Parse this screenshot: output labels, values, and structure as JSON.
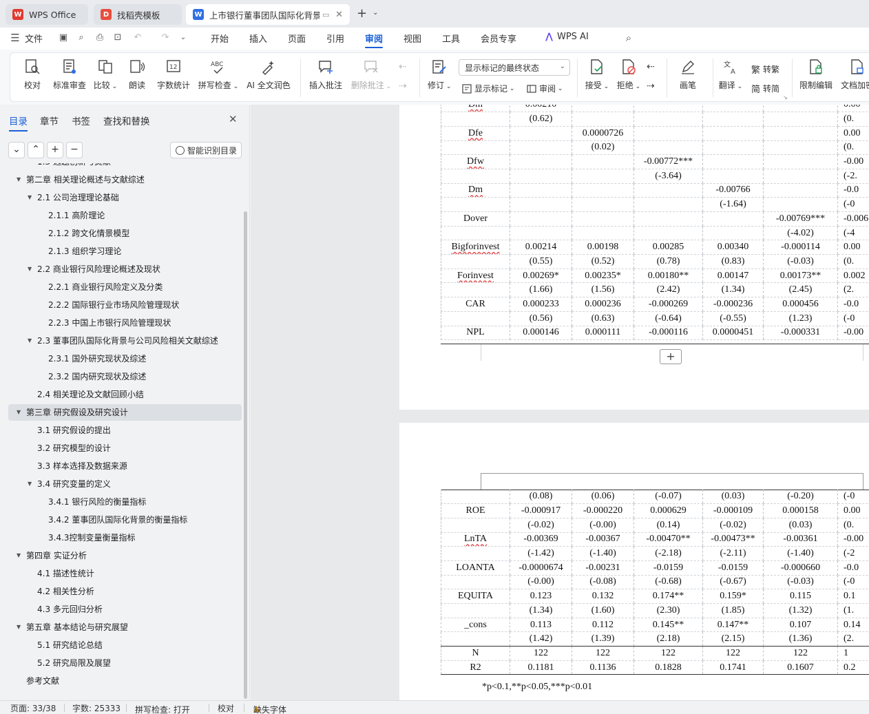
{
  "tabs": [
    {
      "label": "WPS Office",
      "icon": "wps-logo-icon"
    },
    {
      "label": "找稻壳模板",
      "icon": "docer-icon"
    },
    {
      "label": "上市银行董事团队国际化背景对",
      "icon": "word-doc-icon"
    }
  ],
  "menu": {
    "file": "文件",
    "items": [
      "开始",
      "插入",
      "页面",
      "引用",
      "审阅",
      "视图",
      "工具",
      "会员专享"
    ],
    "active": "审阅",
    "ai": "WPS AI"
  },
  "ribbon": {
    "proof": "校对",
    "standard_review": "标准审查",
    "compare": "比较",
    "read_aloud": "朗读",
    "word_count": "字数统计",
    "spell_check": "拼写检查",
    "ai_polish": "AI 全文润色",
    "insert_comment": "插入批注",
    "delete_comment": "删除批注",
    "revise": "修订",
    "show_markup": "显示标记",
    "review": "审阅",
    "display_state": "显示标记的最终状态",
    "accept": "接受",
    "reject": "拒绝",
    "pen": "画笔",
    "translate": "翻译",
    "to_trad": "转繁",
    "to_simp": "转简",
    "restrict_edit": "限制编辑",
    "doc_encrypt": "文档加密"
  },
  "panel": {
    "tabs": [
      "目录",
      "章节",
      "书签",
      "查找和替换"
    ],
    "active_tab": "目录",
    "ai_toc": "智能识别目录",
    "toc": [
      {
        "label": "1.3  选题创新与贡献",
        "level": 2
      },
      {
        "label": "第二章  相关理论概述与文献综述",
        "level": 1,
        "expanded": true
      },
      {
        "label": "2.1  公司治理理论基础",
        "level": 2,
        "expanded": true
      },
      {
        "label": "2.1.1  高阶理论",
        "level": 3
      },
      {
        "label": "2.1.2  跨文化情景模型",
        "level": 3
      },
      {
        "label": "2.1.3 组织学习理论",
        "level": 3
      },
      {
        "label": "2.2 商业银行风险理论概述及现状",
        "level": 2,
        "expanded": true
      },
      {
        "label": "2.2.1  商业银行风险定义及分类",
        "level": 3
      },
      {
        "label": "2.2.2  国际银行业市场风险管理现状",
        "level": 3
      },
      {
        "label": "2.2.3  中国上市银行风险管理现状",
        "level": 3
      },
      {
        "label": "2.3  董事团队国际化背景与公司风险相关文献综述",
        "level": 2,
        "expanded": true
      },
      {
        "label": "2.3.1  国外研究现状及综述",
        "level": 3
      },
      {
        "label": "2.3.2  国内研究现状及综述",
        "level": 3
      },
      {
        "label": "2.4 相关理论及文献回顾小结",
        "level": 2
      },
      {
        "label": "第三章  研究假设及研究设计",
        "level": 1,
        "expanded": true,
        "selected": true
      },
      {
        "label": "3.1  研究假设的提出",
        "level": 2
      },
      {
        "label": "3.2  研究模型的设计",
        "level": 2
      },
      {
        "label": "3.3  样本选择及数据来源",
        "level": 2
      },
      {
        "label": "3.4  研究变量的定义",
        "level": 2,
        "expanded": true
      },
      {
        "label": "3.4.1  银行风险的衡量指标",
        "level": 3
      },
      {
        "label": "3.4.2  董事团队国际化背景的衡量指标",
        "level": 3
      },
      {
        "label": "3.4.3控制变量衡量指标",
        "level": 3
      },
      {
        "label": "第四章  实证分析",
        "level": 1,
        "expanded": true
      },
      {
        "label": "4.1  描述性统计",
        "level": 2
      },
      {
        "label": "4.2  相关性分析",
        "level": 2
      },
      {
        "label": "4.3  多元回归分析",
        "level": 2
      },
      {
        "label": "第五章  基本结论与研究展望",
        "level": 1,
        "expanded": true
      },
      {
        "label": "5.1 研究结论总结",
        "level": 2
      },
      {
        "label": "5.2  研究局限及展望",
        "level": 2
      },
      {
        "label": "参考文献",
        "level": 1
      }
    ]
  },
  "table_top": [
    [
      "Dm",
      "0.00210",
      "",
      "",
      "",
      "",
      ""
    ],
    [
      "",
      "(0.62)",
      "",
      "",
      "",
      "",
      ""
    ],
    [
      "Dfe",
      "",
      "0.0000726",
      "",
      "",
      "",
      ""
    ],
    [
      "",
      "",
      "(0.02)",
      "",
      "",
      "",
      ""
    ],
    [
      "Dfw",
      "",
      "",
      "-0.00772***",
      "",
      "",
      ""
    ],
    [
      "",
      "",
      "",
      "(-3.64)",
      "",
      "",
      ""
    ],
    [
      "Dm",
      "",
      "",
      "",
      "-0.00766",
      "",
      ""
    ],
    [
      "",
      "",
      "",
      "",
      "(-1.64)",
      "",
      ""
    ],
    [
      "Dover",
      "",
      "",
      "",
      "",
      "-0.00769***",
      ""
    ],
    [
      "",
      "",
      "",
      "",
      "",
      "(-4.02)",
      ""
    ],
    [
      "Bigforinvest",
      "0.00214",
      "0.00198",
      "0.00285",
      "0.00340",
      "-0.000114",
      ""
    ],
    [
      "",
      "(0.55)",
      "(0.52)",
      "(0.78)",
      "(0.83)",
      "(-0.03)",
      ""
    ],
    [
      "Forinvest",
      "0.00269*",
      "0.00235*",
      "0.00180**",
      "0.00147",
      "0.00173**",
      ""
    ],
    [
      "",
      "(1.66)",
      "(1.56)",
      "(2.42)",
      "(1.34)",
      "(2.45)",
      ""
    ],
    [
      "CAR",
      "0.000233",
      "0.000236",
      "-0.000269",
      "-0.000236",
      "0.000456",
      ""
    ],
    [
      "",
      "(0.56)",
      "(0.63)",
      "(-0.64)",
      "(-0.55)",
      "(1.23)",
      ""
    ],
    [
      "NPL",
      "0.000146",
      "0.000111",
      "-0.000116",
      "0.0000451",
      "-0.000331",
      ""
    ]
  ],
  "table_top_clip": [
    "0.00",
    "(0.",
    "0.00",
    "(0.",
    "-0.00",
    "(-2.",
    "-0.0",
    "(-0",
    "-0.006",
    "(-4",
    "0.00",
    "(0.",
    "0.002",
    "(2.",
    "-0.0",
    "(-0",
    "-0.00"
  ],
  "table_bottom": [
    [
      "",
      "(0.08)",
      "(0.06)",
      "(-0.07)",
      "(0.03)",
      "(-0.20)",
      "(-0"
    ],
    [
      "ROE",
      "-0.000917",
      "-0.000220",
      "0.000629",
      "-0.000109",
      "0.000158",
      "0.00"
    ],
    [
      "",
      "(-0.02)",
      "(-0.00)",
      "(0.14)",
      "(-0.02)",
      "(0.03)",
      "(0."
    ],
    [
      "LnTA",
      "-0.00369",
      "-0.00367",
      "-0.00470**",
      "-0.00473**",
      "-0.00361",
      "-0.00"
    ],
    [
      "",
      "(-1.42)",
      "(-1.40)",
      "(-2.18)",
      "(-2.11)",
      "(-1.40)",
      "(-2"
    ],
    [
      "LOANTA",
      "-0.0000674",
      "-0.00231",
      "-0.0159",
      "-0.0159",
      "-0.000660",
      "-0.0"
    ],
    [
      "",
      "(-0.00)",
      "(-0.08)",
      "(-0.68)",
      "(-0.67)",
      "(-0.03)",
      "(-0"
    ],
    [
      "EQUITA",
      "0.123",
      "0.132",
      "0.174**",
      "0.159*",
      "0.115",
      "0.1"
    ],
    [
      "",
      "(1.34)",
      "(1.60)",
      "(2.30)",
      "(1.85)",
      "(1.32)",
      "(1."
    ],
    [
      "_cons",
      "0.113",
      "0.112",
      "0.145**",
      "0.147**",
      "0.107",
      "0.14"
    ],
    [
      "",
      "(1.42)",
      "(1.39)",
      "(2.18)",
      "(2.15)",
      "(1.36)",
      "(2."
    ],
    [
      "N",
      "122",
      "122",
      "122",
      "122",
      "122",
      "1"
    ],
    [
      "R2",
      "0.1181",
      "0.1136",
      "0.1828",
      "0.1741",
      "0.1607",
      "0.2"
    ]
  ],
  "footnote": "*p<0.1,**p<0.05,***p<0.01",
  "status": {
    "page": "页面: 33/38",
    "words": "字数: 25333",
    "spell": "拼写检查: 打开",
    "proof": "校对",
    "missing_font": "缺失字体"
  }
}
